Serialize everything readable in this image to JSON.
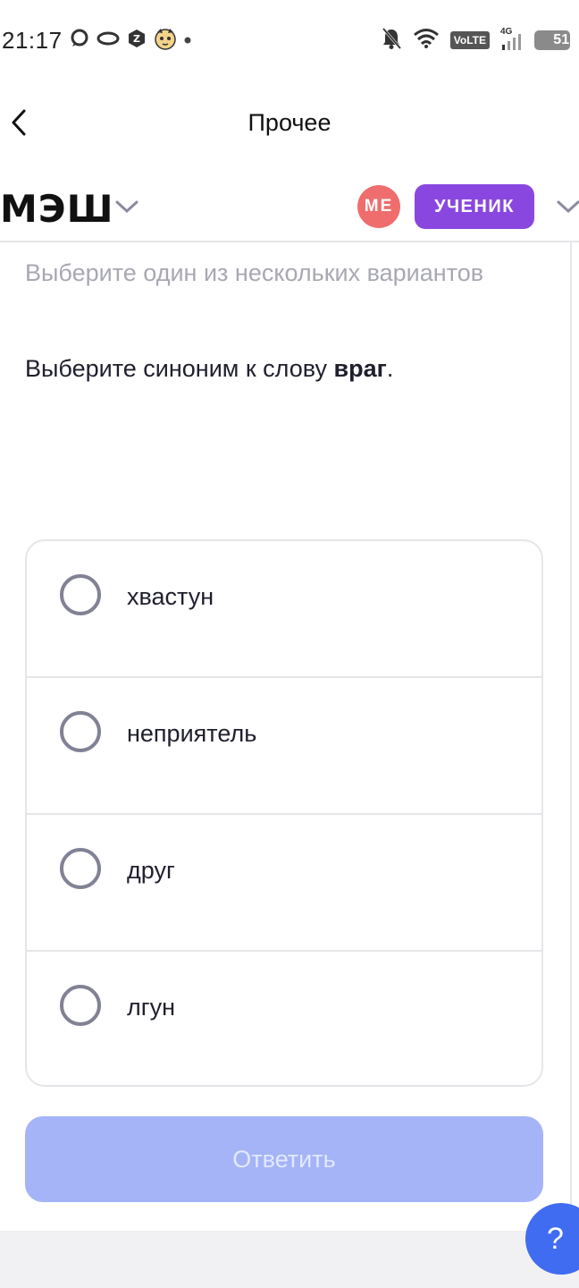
{
  "status_bar": {
    "time": "21:17",
    "network": "4G",
    "volte": "VoLTE",
    "battery": "51"
  },
  "header": {
    "title": "Прочее"
  },
  "brand": {
    "logo_text": "МЭШ",
    "avatar_initials": "МЕ",
    "role": "УЧЕНИК"
  },
  "task": {
    "instruction": "Выберите один из нескольких вариантов",
    "question_prefix": "Выберите синоним к слову ",
    "question_word": "враг",
    "question_suffix": ".",
    "options": [
      {
        "label": "хвастун"
      },
      {
        "label": "неприятель"
      },
      {
        "label": "друг"
      },
      {
        "label": "лгун"
      }
    ],
    "submit_label": "Ответить"
  },
  "help": {
    "label": "?"
  },
  "colors": {
    "accent": "#8a47e0",
    "avatar": "#f06d6d",
    "submit_disabled": "#a5b4f7",
    "help": "#3f6cf0"
  }
}
